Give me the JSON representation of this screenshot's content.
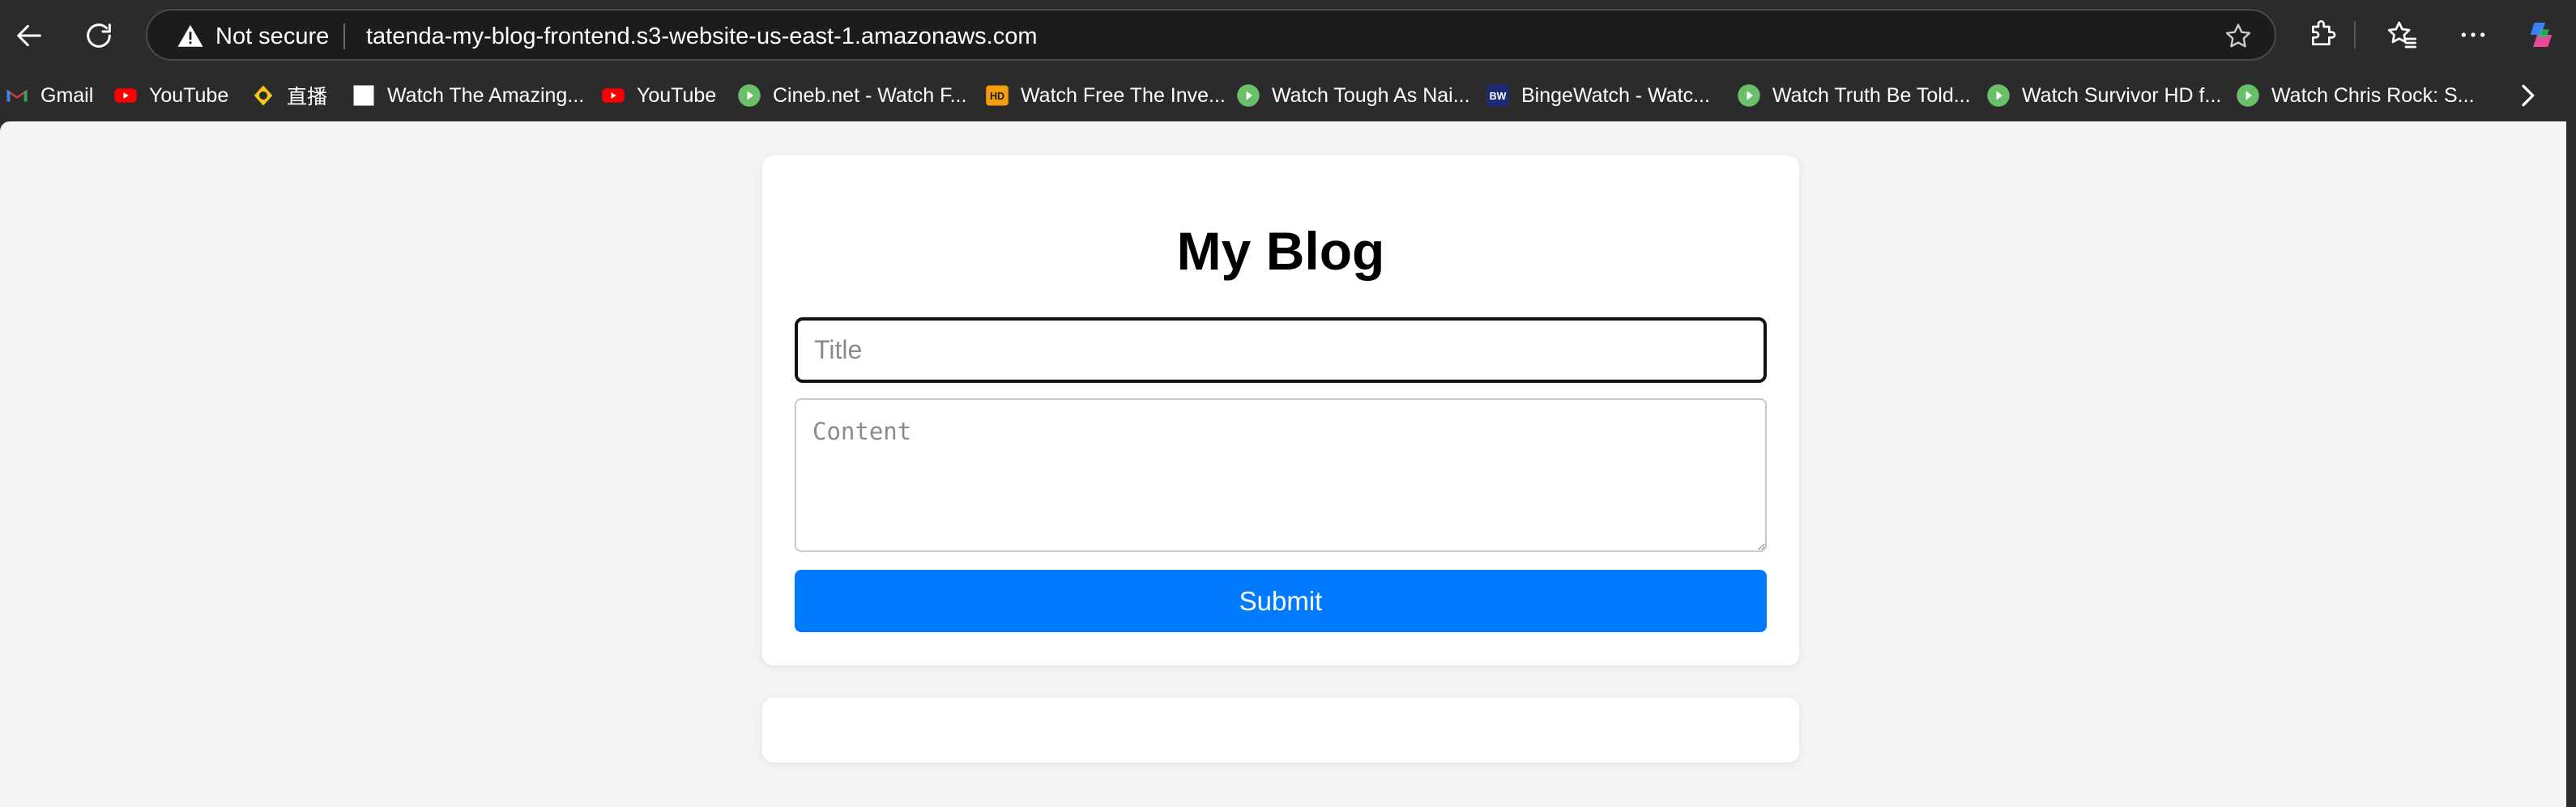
{
  "browser": {
    "security_label": "Not secure",
    "url": "tatenda-my-blog-frontend.s3-website-us-east-1.amazonaws.com",
    "icons": {
      "back": "back-arrow-icon",
      "refresh": "refresh-icon",
      "warning": "warning-triangle-icon",
      "favorite": "star-icon",
      "extensions": "puzzle-icon",
      "favorites": "favorites-star-icon",
      "more": "more-dots-icon",
      "copilot": "copilot-icon"
    }
  },
  "bookmarks": [
    {
      "label": "Gmail",
      "icon": "gmail-icon"
    },
    {
      "label": "YouTube",
      "icon": "youtube-icon"
    },
    {
      "label": "直播",
      "icon": "live-icon"
    },
    {
      "label": "Watch The Amazing...",
      "icon": "blank-page-icon"
    },
    {
      "label": "YouTube",
      "icon": "youtube-icon"
    },
    {
      "label": "Cineb.net - Watch F...",
      "icon": "play-circle-icon"
    },
    {
      "label": "Watch Free The Inve...",
      "icon": "hd-icon"
    },
    {
      "label": "Watch Tough As Nai...",
      "icon": "play-circle-icon"
    },
    {
      "label": "BingeWatch - Watc...",
      "icon": "bw-icon"
    },
    {
      "label": "Watch Truth Be Told...",
      "icon": "play-circle-icon"
    },
    {
      "label": "Watch Survivor HD f...",
      "icon": "play-circle-icon"
    },
    {
      "label": "Watch Chris Rock: S...",
      "icon": "play-circle-icon"
    }
  ],
  "page": {
    "title": "My Blog",
    "title_placeholder": "Title",
    "content_placeholder": "Content",
    "submit_label": "Submit"
  },
  "colors": {
    "accent": "#007bff",
    "page_bg": "#f4f4f4",
    "chrome_bg": "#2b2b2b"
  }
}
